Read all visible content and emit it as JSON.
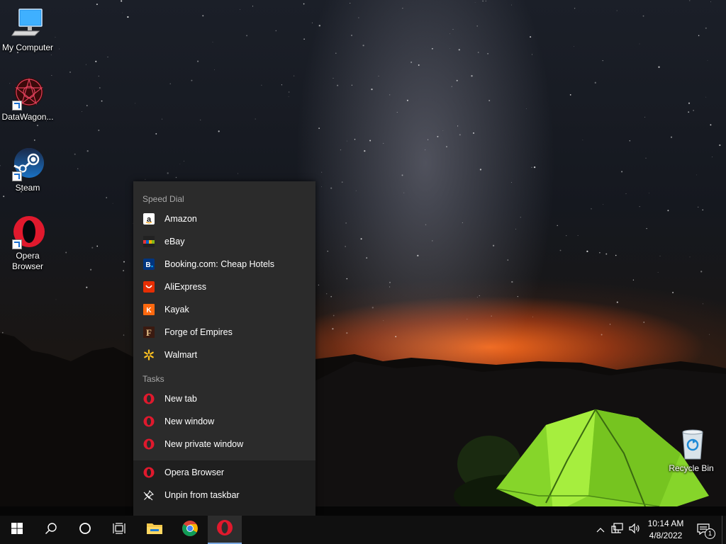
{
  "desktop": {
    "icons": [
      {
        "label": "My Computer"
      },
      {
        "label": "DataWagon..."
      },
      {
        "label": "Steam"
      },
      {
        "label": "Opera\nBrowser"
      },
      {
        "label": "Recycle Bin"
      }
    ]
  },
  "jumplist": {
    "speed_dial_header": "Speed Dial",
    "speed_dial": [
      {
        "label": "Amazon",
        "icon": "amazon-icon"
      },
      {
        "label": "eBay",
        "icon": "ebay-icon"
      },
      {
        "label": "Booking.com: Cheap Hotels",
        "icon": "booking-icon"
      },
      {
        "label": "AliExpress",
        "icon": "aliexpress-icon"
      },
      {
        "label": "Kayak",
        "icon": "kayak-icon"
      },
      {
        "label": "Forge of Empires",
        "icon": "forge-of-empires-icon"
      },
      {
        "label": "Walmart",
        "icon": "walmart-icon"
      }
    ],
    "tasks_header": "Tasks",
    "tasks": [
      {
        "label": "New tab",
        "icon": "opera-icon"
      },
      {
        "label": "New window",
        "icon": "opera-icon"
      },
      {
        "label": "New private window",
        "icon": "opera-icon"
      }
    ],
    "bottom": [
      {
        "label": "Opera Browser",
        "icon": "opera-icon"
      },
      {
        "label": "Unpin from taskbar",
        "icon": "unpin-icon"
      }
    ]
  },
  "taskbar": {
    "buttons": [
      "start-icon",
      "search-icon",
      "cortana-icon",
      "task-view-icon",
      "file-explorer-icon",
      "chrome-icon",
      "opera-icon"
    ],
    "clock": {
      "time": "10:14 AM",
      "date": "4/8/2022"
    },
    "notification_count": "1"
  },
  "colors": {
    "jumplist_bg": "#2b2b2b",
    "jumplist_bottom_bg": "#1f1f1f",
    "taskbar_bg": "#101010",
    "opera_red": "#e0192d"
  }
}
